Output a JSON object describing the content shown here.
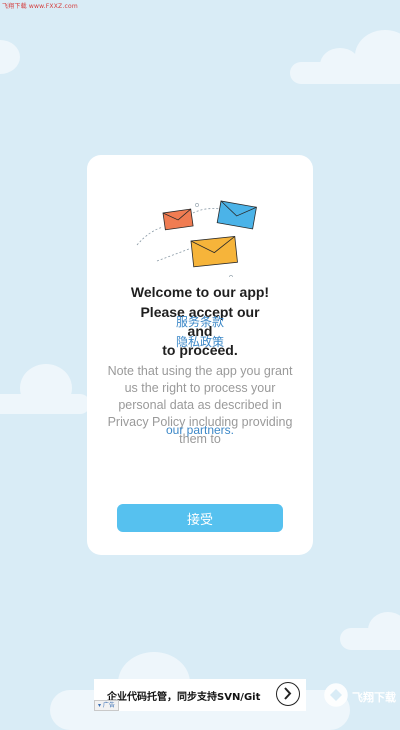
{
  "watermark_top": "飞翔下载 www.FXXZ.com",
  "dialog": {
    "welcome": "Welcome to our app!",
    "please_accept": "Please accept our",
    "terms_link": "服务条款",
    "and": "and",
    "privacy_link": "隐私政策",
    "to_proceed": "to proceed.",
    "note": "Note that using the app you grant us the right to process your personal data as described in Privacy Policy including providing them to",
    "partners_link": "our partners.",
    "accept_button": "接受"
  },
  "ad": {
    "text": "企业代码托管，同步支持SVN/Git",
    "tag": "广告"
  },
  "colors": {
    "background": "#d9ecf6",
    "card": "#ffffff",
    "accent": "#56c1ef",
    "link": "#3b87c7",
    "envelope_red": "#f07c52",
    "envelope_blue": "#4bb3e8",
    "envelope_orange": "#f6b43a"
  },
  "icons": {
    "illustration": "flying-envelopes",
    "ad_arrow": "chevron-right-circle-icon",
    "logo": "fxxz-logo"
  },
  "logo_text": "飞翔下载"
}
